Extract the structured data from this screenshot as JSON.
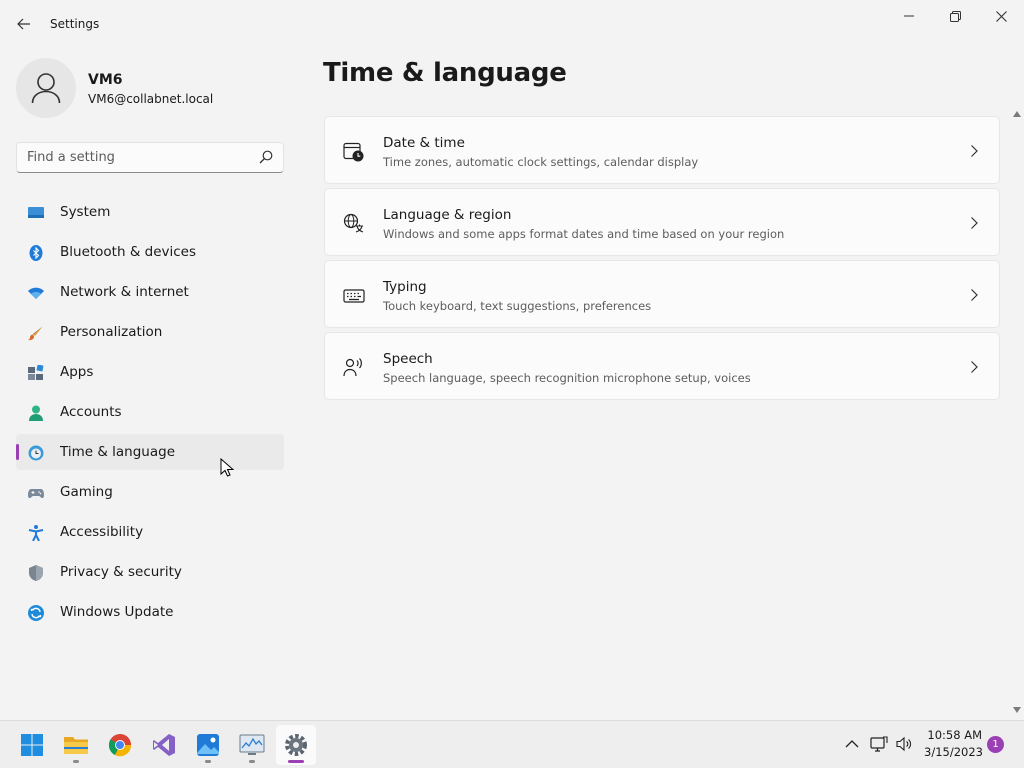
{
  "window": {
    "title": "Settings"
  },
  "user": {
    "name": "VM6",
    "email": "VM6@collabnet.local"
  },
  "search": {
    "placeholder": "Find a setting"
  },
  "nav": {
    "items": [
      {
        "label": "System",
        "icon": "monitor-icon"
      },
      {
        "label": "Bluetooth & devices",
        "icon": "bluetooth-icon"
      },
      {
        "label": "Network & internet",
        "icon": "wifi-icon"
      },
      {
        "label": "Personalization",
        "icon": "brush-icon"
      },
      {
        "label": "Apps",
        "icon": "apps-icon"
      },
      {
        "label": "Accounts",
        "icon": "person-icon"
      },
      {
        "label": "Time & language",
        "icon": "globe-clock-icon",
        "selected": true
      },
      {
        "label": "Gaming",
        "icon": "gamepad-icon"
      },
      {
        "label": "Accessibility",
        "icon": "accessibility-icon"
      },
      {
        "label": "Privacy & security",
        "icon": "shield-icon"
      },
      {
        "label": "Windows Update",
        "icon": "update-icon"
      }
    ]
  },
  "main": {
    "title": "Time & language",
    "cards": [
      {
        "title": "Date & time",
        "description": "Time zones, automatic clock settings, calendar display",
        "icon": "calendar-clock-icon"
      },
      {
        "title": "Language & region",
        "description": "Windows and some apps format dates and time based on your region",
        "icon": "language-icon"
      },
      {
        "title": "Typing",
        "description": "Touch keyboard, text suggestions, preferences",
        "icon": "keyboard-icon"
      },
      {
        "title": "Speech",
        "description": "Speech language, speech recognition microphone setup, voices",
        "icon": "speech-icon"
      }
    ]
  },
  "taskbar": {
    "time": "10:58 AM",
    "date": "3/15/2023",
    "notification_count": "1"
  },
  "colors": {
    "accent": "#9b3fb5",
    "background": "#f3f3f3",
    "card": "#fbfbfb"
  }
}
